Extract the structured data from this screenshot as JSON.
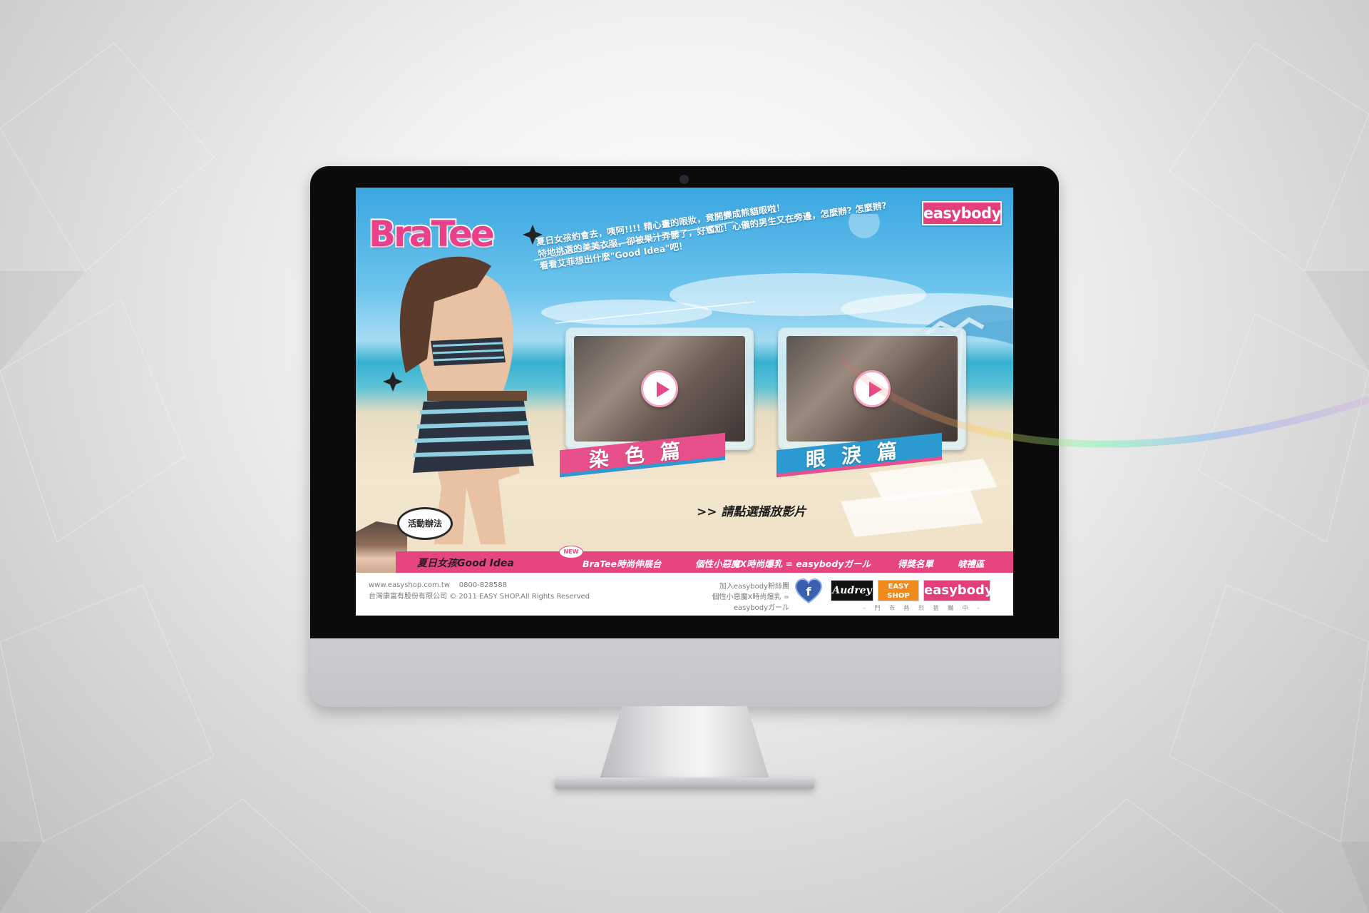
{
  "brand": {
    "bratee_logo": "BraTee",
    "easybody_logo": "easybody"
  },
  "intro": {
    "lines": [
      "夏日女孩約會去，咦阿!!!! 精心畫的眼妝，竟開變成熊貓眼啦！",
      "特地挑選的美美衣服，卻被果汁弄髒了，好尷尬！心儀的男生又在旁邊，怎麼辦? 怎麼辦?",
      "看看艾菲想出什麼\"Good Idea\"吧！"
    ]
  },
  "videos": [
    {
      "label": "染色篇",
      "color": "#e8508c"
    },
    {
      "label": "眼淚篇",
      "color": "#2b9ad1"
    }
  ],
  "hint": "請點選播放影片",
  "hint_prefix": ">>",
  "activity_bubble": "活動辦法",
  "nav": {
    "items": [
      "夏日女孩Good Idea",
      "BraTee時尚伸展台",
      "個性小惡魔X時尚爆乳 = easybodyガール",
      "得獎名單",
      "唬禮區"
    ],
    "new_badge": "NEW"
  },
  "footer": {
    "site": "www.easyshop.com.tw",
    "phone": "0800-828588",
    "copyright": "台灣康富有股份有限公司 © 2011 EASY SHOP.All Rights Reserved",
    "fb_line1": "加入easybody粉絲團",
    "fb_line2": "個性小惡魔X時尚爆乳 = easybodyガール",
    "brands": [
      "Audrey",
      "EASY SHOP",
      "easybody"
    ],
    "stores_note": "- 門 市 熱 烈 搶 購 中 -"
  },
  "colors": {
    "accent_pink": "#e6457f",
    "accent_blue": "#2b9ad1"
  }
}
